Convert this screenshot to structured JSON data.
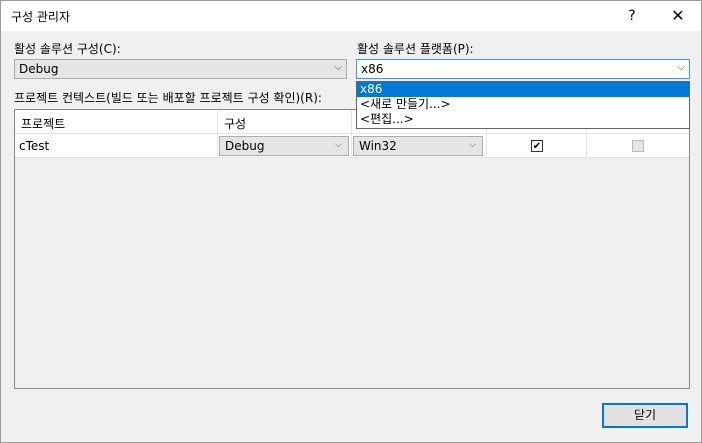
{
  "dialog": {
    "title": "구성 관리자",
    "help_glyph": "?",
    "close_glyph": "✕"
  },
  "active_config": {
    "label": "활성 솔루션 구성(C):",
    "value": "Debug"
  },
  "active_platform": {
    "label": "활성 솔루션 플랫폼(P):",
    "value": "x86",
    "options": [
      "x86",
      "<새로 만들기...>",
      "<편집...>"
    ],
    "selected_index": 0
  },
  "project_contexts": {
    "label": "프로젝트 컨텍스트(빌드 또는 배포할 프로젝트 구성 확인)(R):",
    "columns": [
      "프로젝트",
      "구성"
    ],
    "rows": [
      {
        "project": "cTest",
        "config": "Debug",
        "platform": "Win32",
        "build": true,
        "deploy": false,
        "deploy_enabled": false
      }
    ]
  },
  "buttons": {
    "close_label": "닫기"
  },
  "icons": {
    "dropdown_arrow": "chevron-down-icon",
    "check": "checkmark-icon"
  }
}
